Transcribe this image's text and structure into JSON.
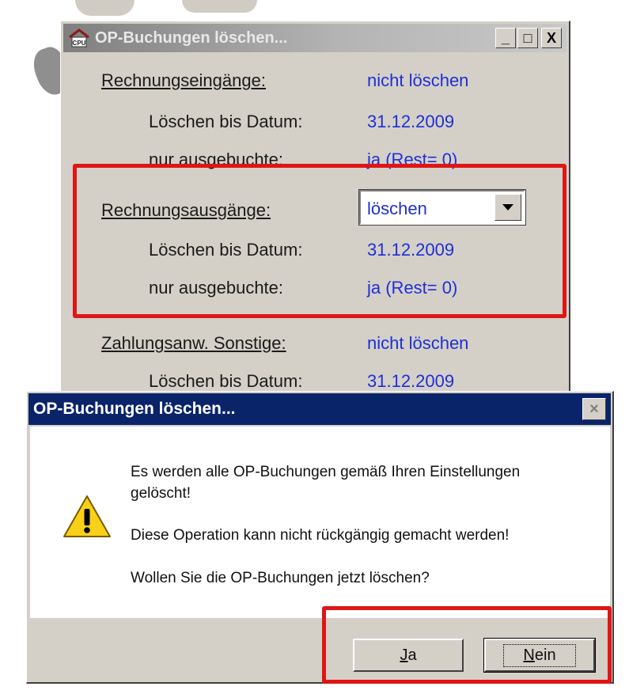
{
  "main_window": {
    "title": "OP-Buchungen löschen...",
    "controls": {
      "minimize": "_",
      "maximize": "□",
      "close": "X"
    },
    "sections": [
      {
        "heading": "Rechnungseingänge:",
        "mode": "nicht löschen",
        "date_label": "Löschen bis Datum:",
        "date_value": "31.12.2009",
        "only_label": "nur ausgebuchte:",
        "only_value": "ja (Rest= 0)"
      },
      {
        "heading": "Rechnungsausgänge:",
        "mode": "löschen",
        "date_label": "Löschen bis Datum:",
        "date_value": "31.12.2009",
        "only_label": "nur ausgebuchte:",
        "only_value": "ja (Rest= 0)"
      },
      {
        "heading": "Zahlungsanw. Sonstige:",
        "mode": "nicht löschen",
        "date_label": "Löschen bis Datum:",
        "date_value": "31.12.2009"
      }
    ]
  },
  "dialog": {
    "title": "OP-Buchungen löschen...",
    "close": "×",
    "icon": "warning-icon",
    "message_line1": "Es werden alle OP-Buchungen gemäß Ihren Einstellungen gelöscht!",
    "message_line2": "Diese Operation kann nicht rückgängig gemacht werden!",
    "message_line3": "Wollen Sie die OP-Buchungen jetzt löschen?",
    "yes_mnemonic": "J",
    "yes_rest": "a",
    "no_mnemonic": "N",
    "no_rest": "ein"
  },
  "colors": {
    "value_blue": "#1f2fd6",
    "highlight_red": "#e01515",
    "dialog_title_bg": "#0a246a",
    "inactive_title_bg": "#8a8a8a"
  }
}
